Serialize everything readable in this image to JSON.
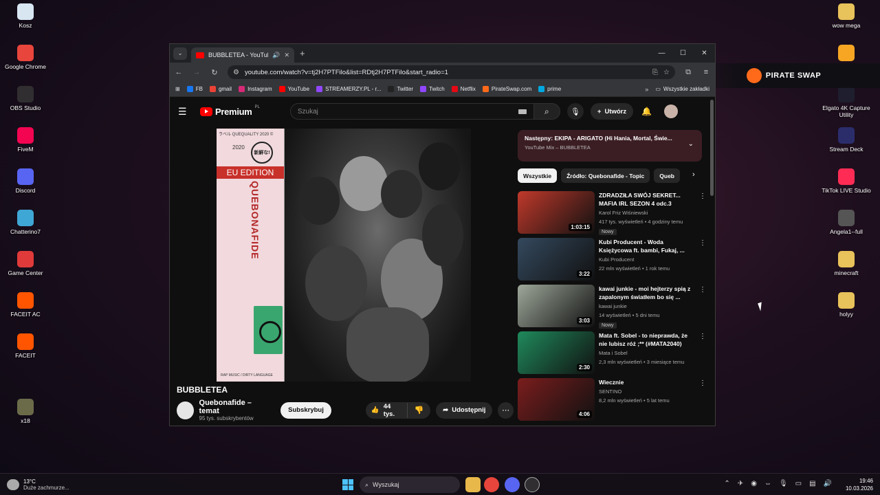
{
  "desktop": {
    "left_icons": [
      {
        "label": "Kosz",
        "icon": "recycle-bin-icon",
        "color": "#d8e6f2"
      },
      {
        "label": "Google Chrome",
        "icon": "chrome-icon",
        "color": "#e8453c"
      },
      {
        "label": "OBS Studio",
        "icon": "obs-icon",
        "color": "#302e31"
      },
      {
        "label": "FiveM",
        "icon": "fivem-icon",
        "color": "#f40552"
      },
      {
        "label": "Discord",
        "icon": "discord-icon",
        "color": "#5865f2"
      },
      {
        "label": "Chatterino7",
        "icon": "chatterino-icon",
        "color": "#3fa7d6"
      },
      {
        "label": "Game Center",
        "icon": "game-center-icon",
        "color": "#e03a3a"
      },
      {
        "label": "FACEIT AC",
        "icon": "faceit-ac-icon",
        "color": "#ff5500"
      },
      {
        "label": "FACEIT",
        "icon": "faceit-icon",
        "color": "#ff5500"
      },
      {
        "label": "x18",
        "icon": "x18-icon",
        "color": "#6b6b4a"
      }
    ],
    "right_icons": [
      {
        "label": "wow mega",
        "icon": "folder-icon",
        "color": "#e8c25a"
      },
      {
        "label": "",
        "icon": "app-icon",
        "color": "#f6a623"
      },
      {
        "label": "Elgato 4K Capture Utility",
        "icon": "elgato-icon",
        "color": "#1e1e2e"
      },
      {
        "label": "Stream Deck",
        "icon": "stream-deck-icon",
        "color": "#2b2d6b"
      },
      {
        "label": "TikTok LIVE Studio",
        "icon": "tiktok-icon",
        "color": "#fe2c55"
      },
      {
        "label": "Angela1--full",
        "icon": "file-icon",
        "color": "#555"
      },
      {
        "label": "minecraft",
        "icon": "folder-icon",
        "color": "#e8c25a"
      },
      {
        "label": "holyy",
        "icon": "folder-icon",
        "color": "#e8c25a"
      }
    ],
    "pirate_banner": "PIRATE SWAP"
  },
  "browser": {
    "tab_title": "BUBBLETEA - YouTube",
    "url": "youtube.com/watch?v=tj2H7PTFilo&list=RDtj2H7PTFilo&start_radio=1",
    "bookmarks": [
      {
        "label": "FB",
        "color": "#1877f2"
      },
      {
        "label": "gmail",
        "color": "#ea4335"
      },
      {
        "label": "Instagram",
        "color": "#d62976"
      },
      {
        "label": "YouTube",
        "color": "#ff0000"
      },
      {
        "label": "STREAMERZY.PL - r...",
        "color": "#9146ff"
      },
      {
        "label": "Twitter",
        "color": "#222222"
      },
      {
        "label": "Twitch",
        "color": "#9146ff"
      },
      {
        "label": "Netflix",
        "color": "#e50914"
      },
      {
        "label": "PirateSwap.com",
        "color": "#ff6a1a"
      },
      {
        "label": "prime",
        "color": "#00a8e1"
      }
    ],
    "all_bookmarks": "Wszystkie zakładki"
  },
  "youtube": {
    "logo_text": "Premium",
    "logo_region": "PL",
    "search_placeholder": "Szukaj",
    "create_label": "Utwórz",
    "video_title": "BUBBLETEA",
    "channel_name": "Quebonafide – temat",
    "channel_subs": "95 tys. subskrybentów",
    "subscribe_label": "Subskrybuj",
    "likes": "44 tys.",
    "share_label": "Udostępnij",
    "cover": {
      "header": "ラベル QUEQUALITY 2020 ©",
      "year": "2020",
      "bubble": "新鮮な!",
      "edition": "EU EDITION",
      "vertical": "QUEBONAFIDE",
      "footer": "RAP MUSIC / DIRTY LANGUAGE"
    },
    "up_next_title": "Następny: EKIPA - ARIGATO (Hi Hania, Mortal, Świe...",
    "up_next_sub": "YouTube Mix – BUBBLETEA",
    "chips": [
      "Wszystkie",
      "Źródło: Quebonafide - Topic",
      "Queb"
    ],
    "recommendations": [
      {
        "title": "ZDRADZIŁA SWÓJ SEKRET... MAFIA IRL SEZON 4 odc.3",
        "channel": "Karol Friz Wiśniewski",
        "meta": "417 tys. wyświetleń • 4 godziny temu",
        "badge": "Nowy",
        "duration": "1:03:15",
        "thumb": "#c0392b"
      },
      {
        "title": "Kubi Producent - Woda Księżycowa ft. bambi, Fukaj, ...",
        "channel": "Kubi Producent",
        "meta": "22 mln wyświetleń • 1 rok temu",
        "badge": "",
        "duration": "3:22",
        "thumb": "#34495e"
      },
      {
        "title": "kawai junkie - moi hejterzy spią z zapalonym światłem bo się ...",
        "channel": "kawai junkie",
        "meta": "14 wyświetleń • 5 dni temu",
        "badge": "Nowy",
        "duration": "3:03",
        "thumb": "#9ea89a"
      },
      {
        "title": "Mata ft. Sobel - to nieprawda, że nie lubisz róż ;** (#MATA2040)",
        "channel": "Mata i Sobel",
        "meta": "2,3 mln wyświetleń • 3 miesiące temu",
        "badge": "",
        "duration": "2:30",
        "thumb": "#1f8a5c"
      },
      {
        "title": "Wiecznie",
        "channel": "SENTINO",
        "meta": "8,2 mln wyświetleń • 5 lat temu",
        "badge": "",
        "duration": "4:06",
        "thumb": "#7b1d1d"
      }
    ]
  },
  "taskbar": {
    "temp": "13°C",
    "weather": "Duże zachmurze...",
    "search_label": "Wyszukaj",
    "time": "19:46",
    "date": "10.03.2026"
  }
}
